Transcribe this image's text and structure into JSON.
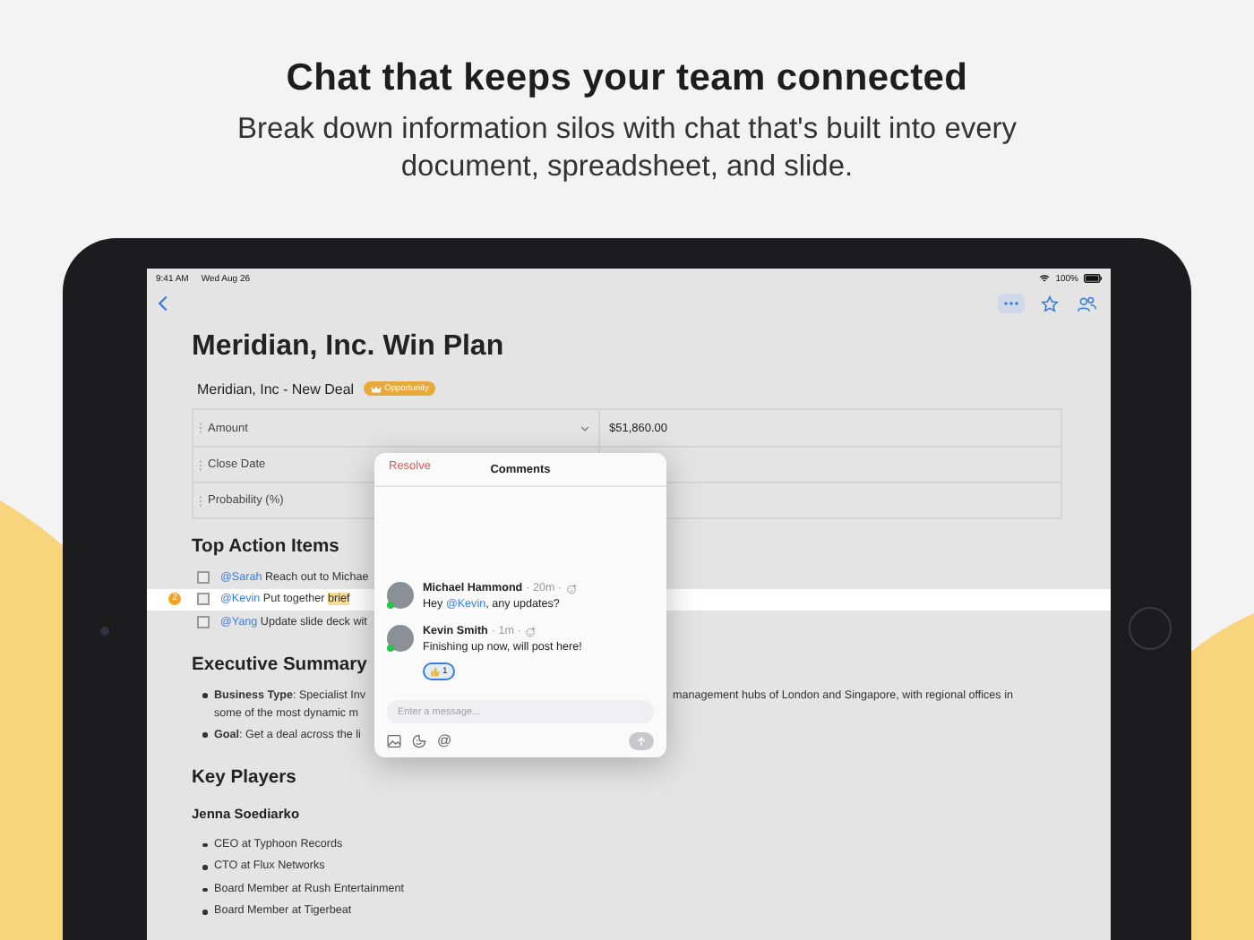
{
  "header": {
    "title": "Chat that keeps your team connected",
    "subtitle": "Break down information silos with chat that's built into every document, spreadsheet, and slide."
  },
  "status_bar": {
    "time": "9:41 AM",
    "date": "Wed Aug 26",
    "battery": "100%"
  },
  "toolbar": [
    {
      "kind": "more",
      "selected": true
    },
    {
      "kind": "star",
      "selected": false
    },
    {
      "kind": "people",
      "selected": false
    }
  ],
  "document": {
    "title": "Meridian, Inc. Win Plan",
    "record": {
      "name": "Meridian, Inc - New Deal",
      "tag": "Opportunity"
    },
    "fields": [
      {
        "label": "Amount",
        "dropdown": true,
        "value": "$51,860.00"
      },
      {
        "label": "Close Date",
        "dropdown": false
      },
      {
        "label": "Probability (%)",
        "dropdown": false
      }
    ],
    "action_heading": "Top Action Items",
    "action_items": [
      {
        "mention": "@Sarah",
        "text": " Reach out to Michae",
        "checked": false,
        "selected": false
      },
      {
        "mention": "@Kevin",
        "text": " Put together ",
        "highlight": "brief",
        "badge": "2",
        "checked": false,
        "selected": true
      },
      {
        "mention": "@Yang",
        "text": " Update slide deck wit",
        "checked": false,
        "selected": false
      }
    ],
    "summary_heading": "Executive Summary",
    "summary": [
      {
        "text": "**Business Type**: Specialist Inv",
        "text_right": "management hubs of London and Singapore, with regional offices in",
        "line2": "some of the most dynamic m"
      },
      {
        "text": "**Goal**: Get a deal across the li"
      }
    ],
    "players_heading": "Key Players",
    "player_name": "Jenna Soediarko",
    "player_roles": [
      "CEO at Typhoon Records",
      "CTO at Flux Networks",
      "Board Member at Rush Entertainment",
      "Board Member at Tigerbeat"
    ]
  },
  "comments_popover": {
    "resolve": "Resolve",
    "title": "Comments",
    "comments": [
      {
        "author": "Michael Hammond",
        "meta": "· 20m ·",
        "online": true,
        "text_before": "Hey ",
        "mention": "@Kevin",
        "text_after": ", any updates?"
      },
      {
        "author": "Kevin Smith",
        "meta": "· 1m ·",
        "online": true,
        "text_before": "Finishing up now, will post here!",
        "reaction_count": "1"
      }
    ],
    "placeholder": "Enter a message...",
    "mention_button": "@"
  }
}
